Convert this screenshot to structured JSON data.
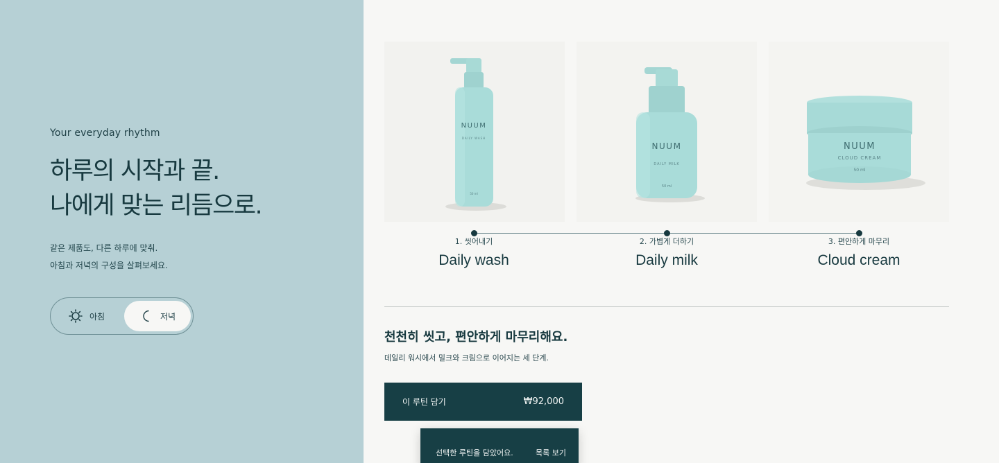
{
  "hero": {
    "eyebrow": "Your everyday rhythm",
    "headline_line1": "하루의 시작과 끝.",
    "headline_line2": "나에게 맞는 리듬으로.",
    "desc_line1": "같은 제품도, 다른 하루에 맞춰.",
    "desc_line2": "아침과 저녁의 구성을 살펴보세요."
  },
  "toggle": {
    "morning_label": "아침",
    "evening_label": "저녁",
    "selected": "저녁"
  },
  "products": [
    {
      "brand": "NUUM",
      "variant": "DAILY WASH",
      "volume": "50 ml",
      "step_label": "1. 씻어내기",
      "name": "Daily wash"
    },
    {
      "brand": "NUUM",
      "variant": "DAILY MILK",
      "volume": "50 ml",
      "step_label": "2. 가볍게 더하기",
      "name": "Daily milk"
    },
    {
      "brand": "NUUM",
      "variant": "CLOUD CREAM",
      "volume": "50 ml",
      "step_label": "3. 편안하게 마무리",
      "name": "Cloud cream"
    }
  ],
  "routine": {
    "title": "천천히 씻고, 편안하게 마무리해요.",
    "subtitle": "데일리 워시에서 밀크와 크림으로 이어지는 세 단계."
  },
  "cta": {
    "label": "이 루틴 담기",
    "price": "₩92,000"
  },
  "toast": {
    "message": "선택한 루틴을 담았어요.",
    "link": "목록 보기"
  },
  "colors": {
    "left_panel": "#b6d0d5",
    "page_bg": "#f7f7f5",
    "dark_teal": "#173f45",
    "product_mint": "#a8dcd9"
  }
}
